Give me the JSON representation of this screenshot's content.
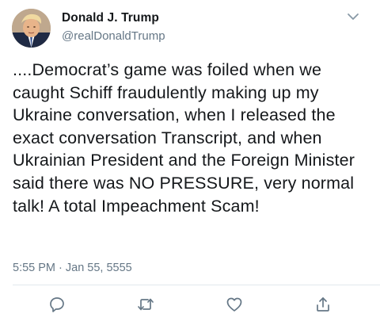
{
  "tweet": {
    "author_name": "Donald J. Trump",
    "handle": "@realDonaldTrump",
    "text": "....Democrat’s game was foiled when we caught Schiff fraudulently making up my Ukraine conversation, when I released the exact conversation Transcript, and when Ukrainian President and the Foreign Minister said there was NO PRESSURE, very normal talk! A total Impeachment Scam!",
    "timestamp": "5:55 PM · Jan 55, 5555"
  },
  "actions": [
    {
      "icon": "reply-icon"
    },
    {
      "icon": "retweet-icon"
    },
    {
      "icon": "like-icon"
    },
    {
      "icon": "share-icon"
    }
  ],
  "colors": {
    "text": "#14171a",
    "secondary": "#657786",
    "divider": "#e1e8ed",
    "icon": "#657786"
  }
}
